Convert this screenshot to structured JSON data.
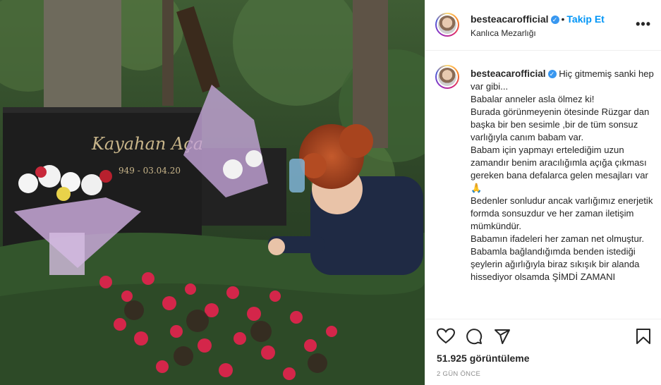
{
  "media": {
    "alt_icon": "video-still",
    "headstone_text": "Kayahan Aça",
    "headstone_dates": "949 - 03.04.20"
  },
  "post_header": {
    "username": "besteacarofficial",
    "verified_icon": "verified-badge-icon",
    "separator": "•",
    "follow_label": "Takip Et",
    "location": "Kanlıca Mezarlığı",
    "more_icon": "more-options-icon"
  },
  "caption": {
    "username": "besteacarofficial",
    "text": " Hiç gitmemiş sanki hep var gibi...\nBabalar anneler asla ölmez ki!\nBurada görünmeyenin ötesinde Rüzgar dan başka bir ben sesimle ,bir de tüm sonsuz varlığıyla canım babam var.\nBabam için yapmayı ertelediğim uzun zamandır benim aracılığımla açığa çıkması gereken bana defalarca gelen mesajları var🙏\nBedenler sonludur ancak varlığımız enerjetik formda sonsuzdur ve her zaman iletişim mümkündür.\nBabamın ifadeleri her zaman net olmuştur.\nBabamla bağlandığımda benden istediği şeylerin ağırlığıyla biraz sıkışık bir alanda hissediyor olsamda ŞİMDİ ZAMANI"
  },
  "actions": {
    "like_icon": "heart-icon",
    "comment_icon": "comment-icon",
    "share_icon": "share-icon",
    "save_icon": "bookmark-icon",
    "views": "51.925 görüntüleme",
    "time": "2 GÜN ÖNCE"
  },
  "colors": {
    "link": "#0095f6",
    "verified": "#3897f0",
    "muted": "#8e8e8e",
    "text": "#262626"
  }
}
